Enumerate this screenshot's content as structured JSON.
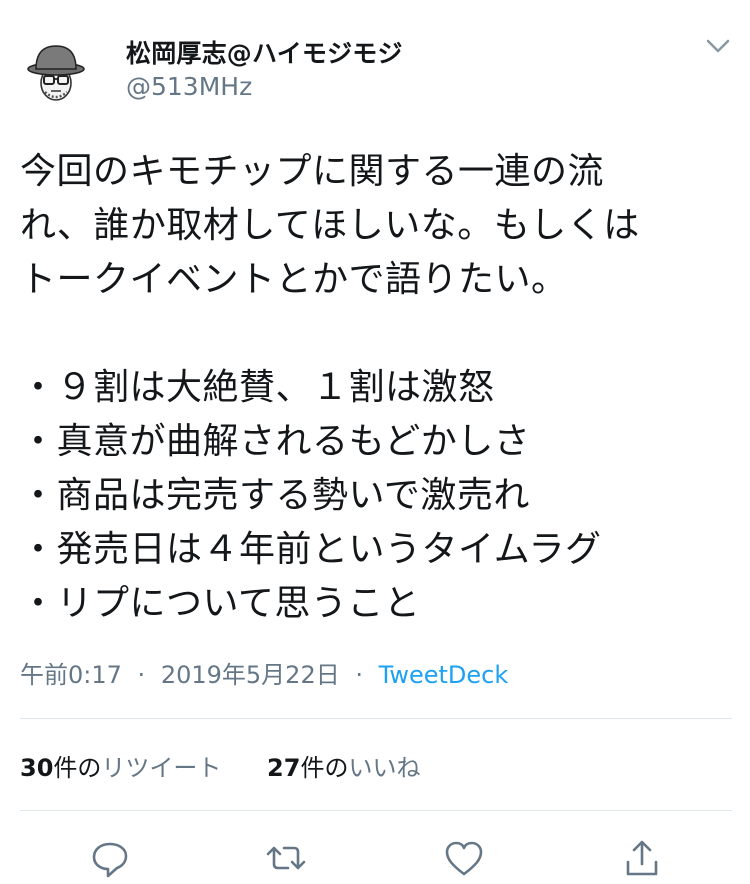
{
  "author": {
    "display_name": "松岡厚志@ハイモジモジ",
    "handle": "@513MHz",
    "avatar_icon": "caricature-avatar-icon"
  },
  "tweet": {
    "lines": [
      "今回のキモチップに関する一連の流",
      "れ、誰か取材してほしいな。もしくは",
      "トークイベントとかで語りたい。",
      "",
      "・９割は大絶賛、１割は激怒",
      "・真意が曲解されるもどかしさ",
      "・商品は完売する勢いで激売れ",
      "・発売日は４年前というタイムラグ",
      "・リプについて思うこと"
    ]
  },
  "meta": {
    "time": "午前0:17",
    "separator": "·",
    "date": "2019年5月22日",
    "source": "TweetDeck"
  },
  "stats": {
    "retweets": {
      "count": "30",
      "unit": "件の",
      "label": "リツイート"
    },
    "likes": {
      "count": "27",
      "unit": "件の",
      "label": "いいね"
    }
  },
  "actions": [
    "reply-icon",
    "retweet-icon",
    "like-icon",
    "share-icon"
  ],
  "colors": {
    "text": "#14171a",
    "secondary": "#657786",
    "link": "#1da1f2",
    "divider": "#e1e8ed"
  }
}
